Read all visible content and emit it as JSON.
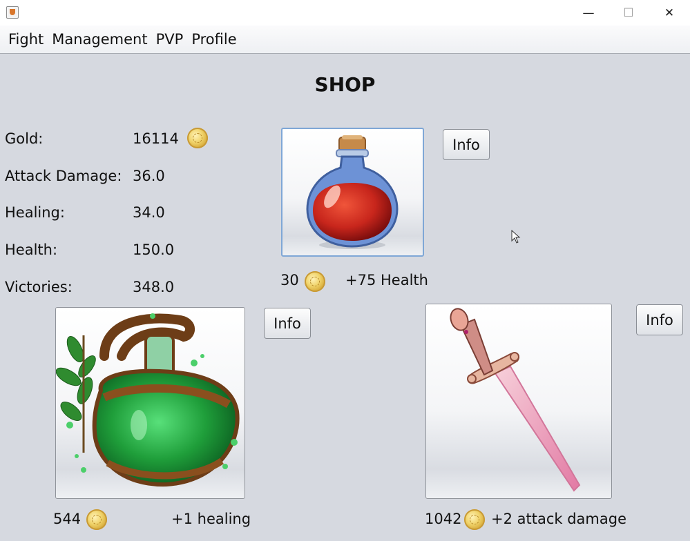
{
  "window": {
    "minimize_glyph": "—",
    "maximize_glyph": "☐",
    "close_glyph": "✕"
  },
  "menu": [
    "Fight",
    "Management",
    "PVP",
    "Profile"
  ],
  "heading": "SHOP",
  "stats": [
    {
      "label": "Gold:",
      "value": "16114"
    },
    {
      "label": "Attack Damage:",
      "value": "36.0"
    },
    {
      "label": "Healing:",
      "value": "34.0"
    },
    {
      "label": "Health:",
      "value": "150.0"
    },
    {
      "label": "Victories:",
      "value": "348.0"
    }
  ],
  "items": [
    {
      "icon": "health-potion-icon",
      "price": "30",
      "effect": "+75 Health",
      "info_label": "Info"
    },
    {
      "icon": "healing-jug-icon",
      "price": "544",
      "effect": "+1 healing",
      "info_label": "Info"
    },
    {
      "icon": "sword-icon",
      "price": "1042",
      "effect": "+2 attack damage",
      "info_label": "Info"
    }
  ],
  "colors": {
    "background": "#d6d9e0",
    "potion_red": "#c8261c",
    "jug_green": "#1f9e3a",
    "sword_pink": "#e9a0b8",
    "coin_gold": "#e2bd4e"
  }
}
